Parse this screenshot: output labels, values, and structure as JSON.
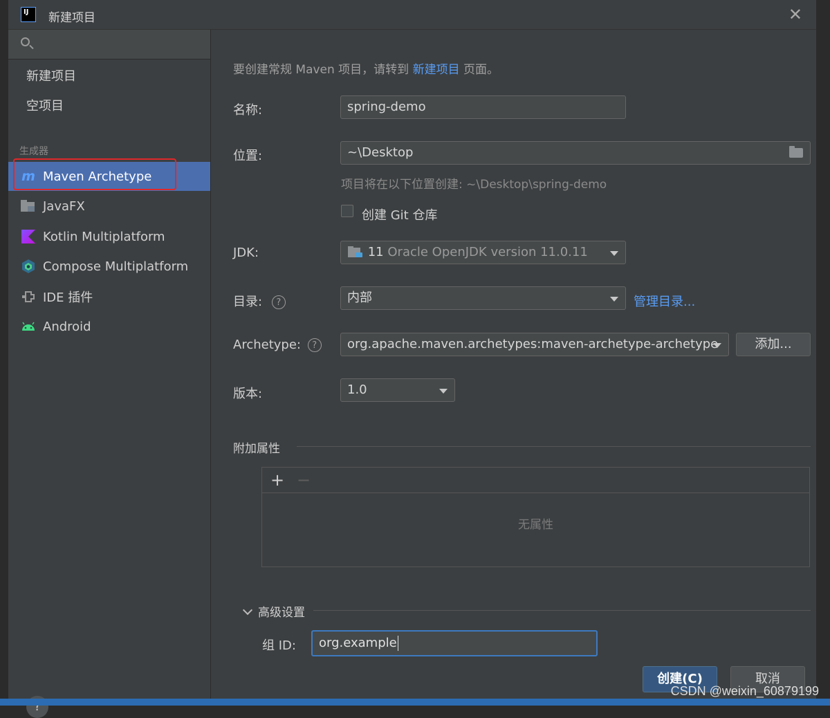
{
  "dialog": {
    "title": "新建项目",
    "close_glyph": "✕"
  },
  "sidebar": {
    "search_placeholder": "",
    "top_items": [
      {
        "label": "新建项目"
      },
      {
        "label": "空项目"
      }
    ],
    "section_label": "生成器",
    "generator_items": [
      {
        "label": "Maven Archetype",
        "icon": "maven-icon",
        "selected": true
      },
      {
        "label": "JavaFX",
        "icon": "javafx-icon"
      },
      {
        "label": "Kotlin Multiplatform",
        "icon": "kotlin-icon"
      },
      {
        "label": "Compose Multiplatform",
        "icon": "compose-icon"
      },
      {
        "label": "IDE 插件",
        "icon": "plugin-icon"
      },
      {
        "label": "Android",
        "icon": "android-icon"
      }
    ],
    "help_label": "?"
  },
  "main": {
    "hint_before": "要创建常规 Maven 项目，请转到 ",
    "hint_link": "新建项目",
    "hint_after": " 页面。",
    "name_label": "名称:",
    "name_value": "spring-demo",
    "location_label": "位置:",
    "location_value": "~\\Desktop",
    "location_hint": "项目将在以下位置创建: ~\\Desktop\\spring-demo",
    "git_label": "创建 Git 仓库",
    "git_checked": false,
    "jdk_label": "JDK:",
    "jdk_version_num": "11",
    "jdk_value": "Oracle OpenJDK version 11.0.11",
    "catalog_label": "目录:",
    "catalog_value": "内部",
    "catalog_link": "管理目录...",
    "archetype_label": "Archetype:",
    "archetype_value": "org.apache.maven.archetypes:maven-archetype-archetype",
    "add_button": "添加...",
    "version_label": "版本:",
    "version_value": "1.0",
    "props_section": "附加属性",
    "props_plus": "+",
    "props_minus": "−",
    "props_empty": "无属性",
    "advanced_section": "高级设置",
    "group_id_label": "组 ID:",
    "group_id_value": "org.example"
  },
  "footer": {
    "create_button": "创建(C)",
    "cancel_button": "取消",
    "watermark": "CSDN @weixin_60879199"
  },
  "colors": {
    "dialog_bg": "#3c3f41",
    "selection": "#4b6eaf",
    "link": "#589df6",
    "highlight_border": "#e0282a",
    "primary_button": "#365880"
  }
}
